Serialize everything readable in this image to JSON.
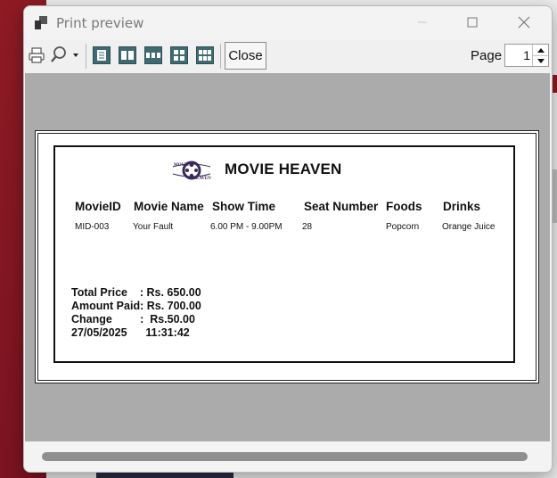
{
  "window": {
    "title": "Print preview",
    "app_icon": "print-preview-app-icon"
  },
  "toolbar": {
    "print_icon": "printer-icon",
    "zoom_icon": "magnifier-icon",
    "layouts": [
      "one-page-icon",
      "two-pages-icon",
      "three-pages-icon",
      "four-pages-icon",
      "six-pages-icon"
    ],
    "close_label": "Close",
    "page_label": "Page",
    "page_value": "1"
  },
  "receipt": {
    "brand": "MOVIE HEAVEN",
    "logo_text_top": "MOVIE",
    "logo_text_bottom": "HEAVEN",
    "columns": [
      "MovieID",
      "Movie Name",
      "Show Time",
      "Seat Number",
      "Foods",
      "Drinks"
    ],
    "row": [
      "MID-003",
      "Your Fault",
      "6.00 PM - 9.00PM",
      "28",
      "Popcorn",
      "Orange Juice"
    ],
    "summary": {
      "total_price": "Total Price    : Rs. 650.00",
      "amount_paid": "Amount Paid: Rs. 700.00",
      "change": "Change         :  Rs.50.00",
      "date_time": "27/05/2025      11:31:42"
    }
  },
  "colors": {
    "layout_button": "#3f6a71",
    "preview_background": "#ababab",
    "app_background_accent": "#8e1a24",
    "logo": "#3a2a5a"
  }
}
